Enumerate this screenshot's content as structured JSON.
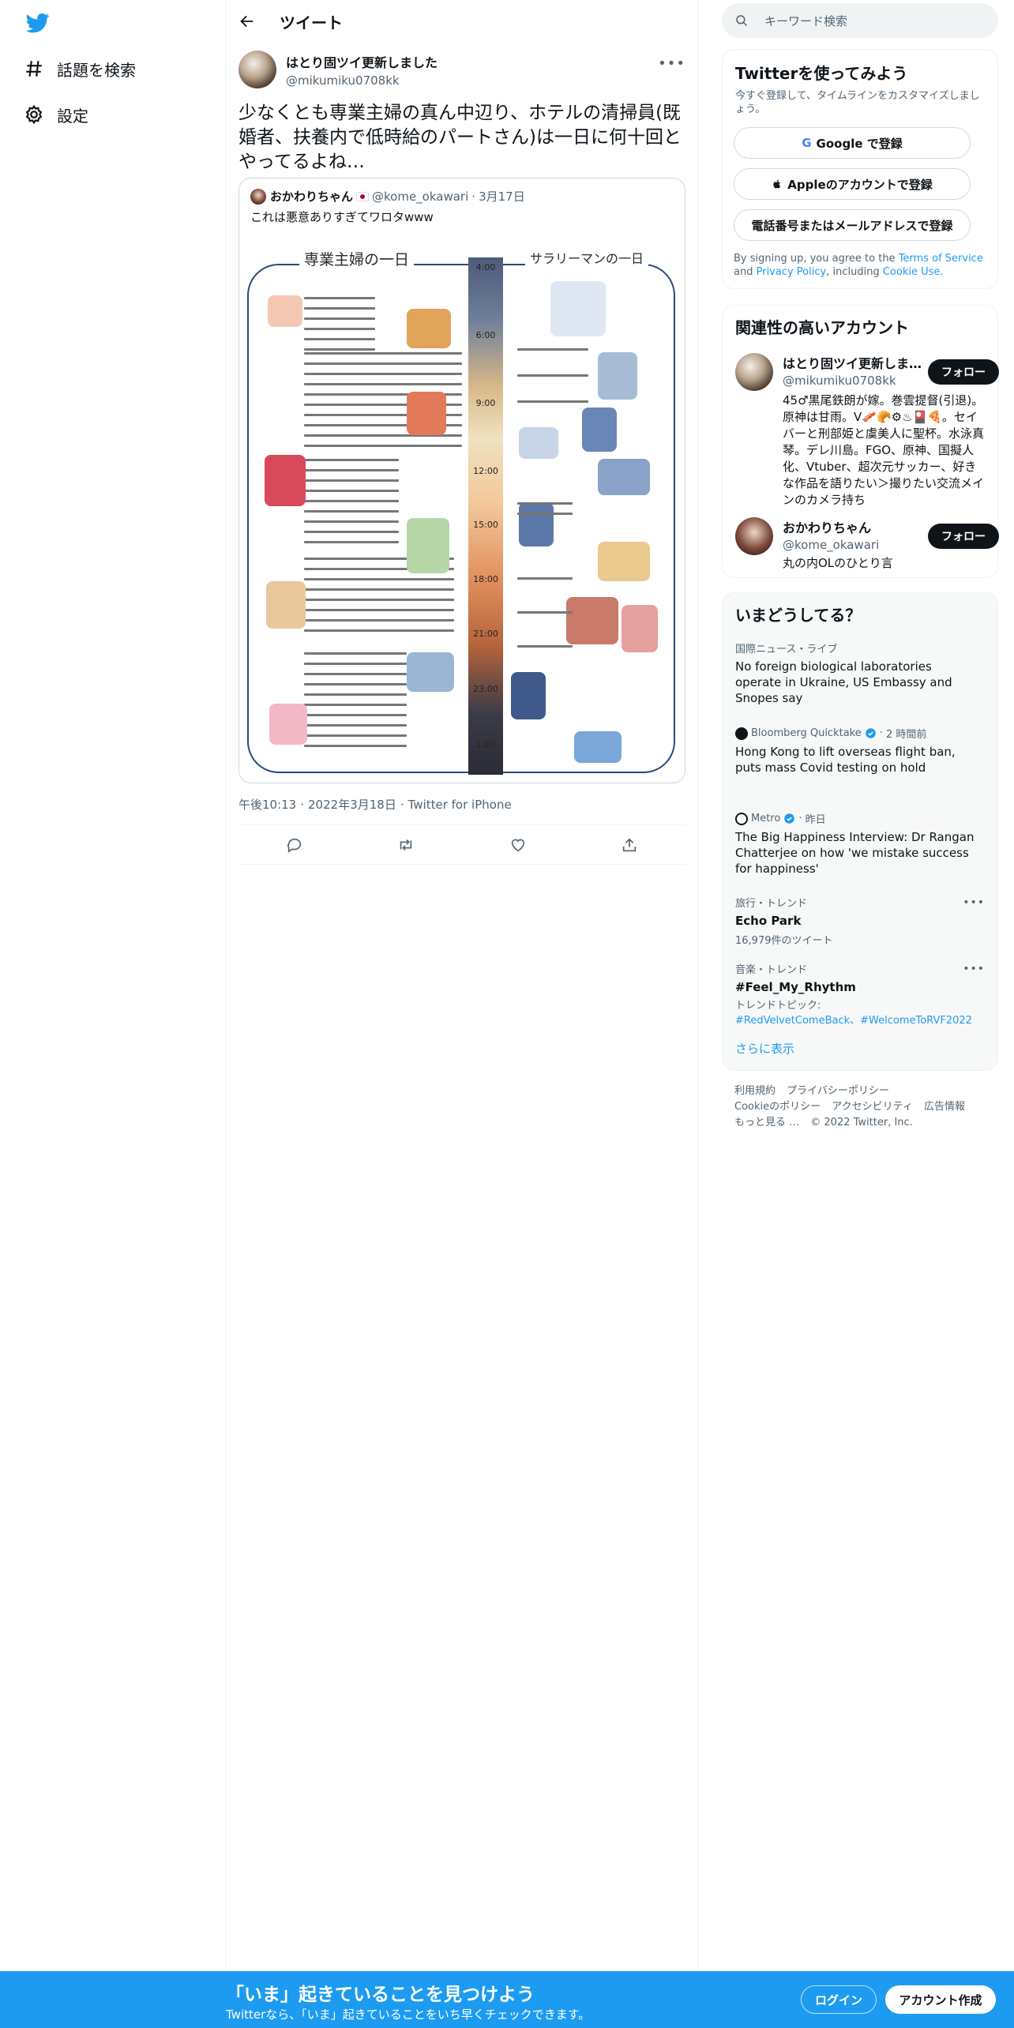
{
  "nav": {
    "items": [
      {
        "label": "話題を検索",
        "icon": "hashtag-icon"
      },
      {
        "label": "設定",
        "icon": "gear-icon"
      }
    ]
  },
  "header": {
    "title": "ツイート"
  },
  "tweet": {
    "author_name": "はとり固ツイ更新しました",
    "author_handle": "@mikumiku0708kk",
    "text": "少なくとも専業主婦の真ん中辺り、ホテルの清掃員(既婚者、扶養内で低時給のパートさん)は一日に何十回とやってるよね…",
    "time": "午後10:13",
    "date": "2022年3月18日",
    "client": "Twitter for iPhone"
  },
  "quote": {
    "name": "おかわりちゃん",
    "handle": "@kome_okawari",
    "date": "3月17日",
    "text": "これは悪意ありすぎてワロタwww",
    "image": {
      "left_title": "専業主婦の一日",
      "right_title": "サラリーマンの一日",
      "times": [
        "4:00",
        "6:00",
        "9:00",
        "12:00",
        "15:00",
        "18:00",
        "21:00",
        "23:00",
        "1:00"
      ]
    }
  },
  "search": {
    "placeholder": "キーワード検索"
  },
  "signup": {
    "title": "Twitterを使ってみよう",
    "subtitle": "今すぐ登録して、タイムラインをカスタマイズしましょう。",
    "google": "Google で登録",
    "apple": "Appleのアカウントで登録",
    "phone": "電話番号またはメールアドレスで登録",
    "terms_pre": "By signing up, you agree to the",
    "terms_tos": "Terms of Service",
    "terms_and": "and",
    "terms_privacy": "Privacy Policy",
    "terms_including": ", including",
    "terms_cookie": "Cookie Use."
  },
  "related": {
    "title": "関連性の高いアカウント",
    "follow_label": "フォロー",
    "users": [
      {
        "name": "はとり固ツイ更新しました",
        "handle": "@mikumiku0708kk",
        "bio": "45♂黒尾鉄朗が嫁。巻雲提督(引退)。原神は甘雨。V🥓🥐⚙♨🎴🍕。セイバーと刑部姫と虞美人に聖杯。水泳真琴。デレ川島。FGO、原神、国擬人化、Vtuber、超次元サッカー、好きな作品を語りたい＞撮りたい交流メインのカメラ持ち"
      },
      {
        "name": "おかわりちゃん",
        "handle": "@kome_okawari",
        "bio": "丸の内OLのひとり言"
      }
    ]
  },
  "trends": {
    "title": "いまどうしてる？",
    "items": [
      {
        "kind": "国際ニュース・ライブ",
        "title": "No foreign biological laboratories operate in Ukraine, US Embassy and Snopes say"
      },
      {
        "source": "Bloomberg Quicktake",
        "time": "2 時間前",
        "title": "Hong Kong to lift overseas flight ban, puts mass Covid testing on hold"
      },
      {
        "source": "Metro",
        "time": "昨日",
        "title": "The Big Happiness Interview: Dr Rangan Chatterjee on how 'we mistake success for happiness'"
      },
      {
        "kind": "旅行・トレンド",
        "title": "Echo Park",
        "count": "16,979件のツイート"
      },
      {
        "kind": "音楽・トレンド",
        "title": "#Feel_My_Rhythm",
        "topics_label": "トレンドトピック:",
        "topics": "#RedVelvetComeBack、#WelcomeToRVF2022"
      }
    ],
    "show_more": "さらに表示"
  },
  "footer": {
    "links": [
      "利用規約",
      "プライバシーポリシー",
      "Cookieのポリシー",
      "アクセシビリティ",
      "広告情報",
      "もっと見る …"
    ],
    "copyright": "© 2022 Twitter, Inc."
  },
  "banner": {
    "title": "「いま」起きていることを見つけよう",
    "subtitle": "Twitterなら、「いま」起きていることをいち早くチェックできます。",
    "login": "ログイン",
    "signup": "アカウント作成"
  },
  "colors": {
    "accent": "#1d9bf0",
    "text": "#0f1419",
    "muted": "#536471",
    "border": "#eff3f4"
  }
}
